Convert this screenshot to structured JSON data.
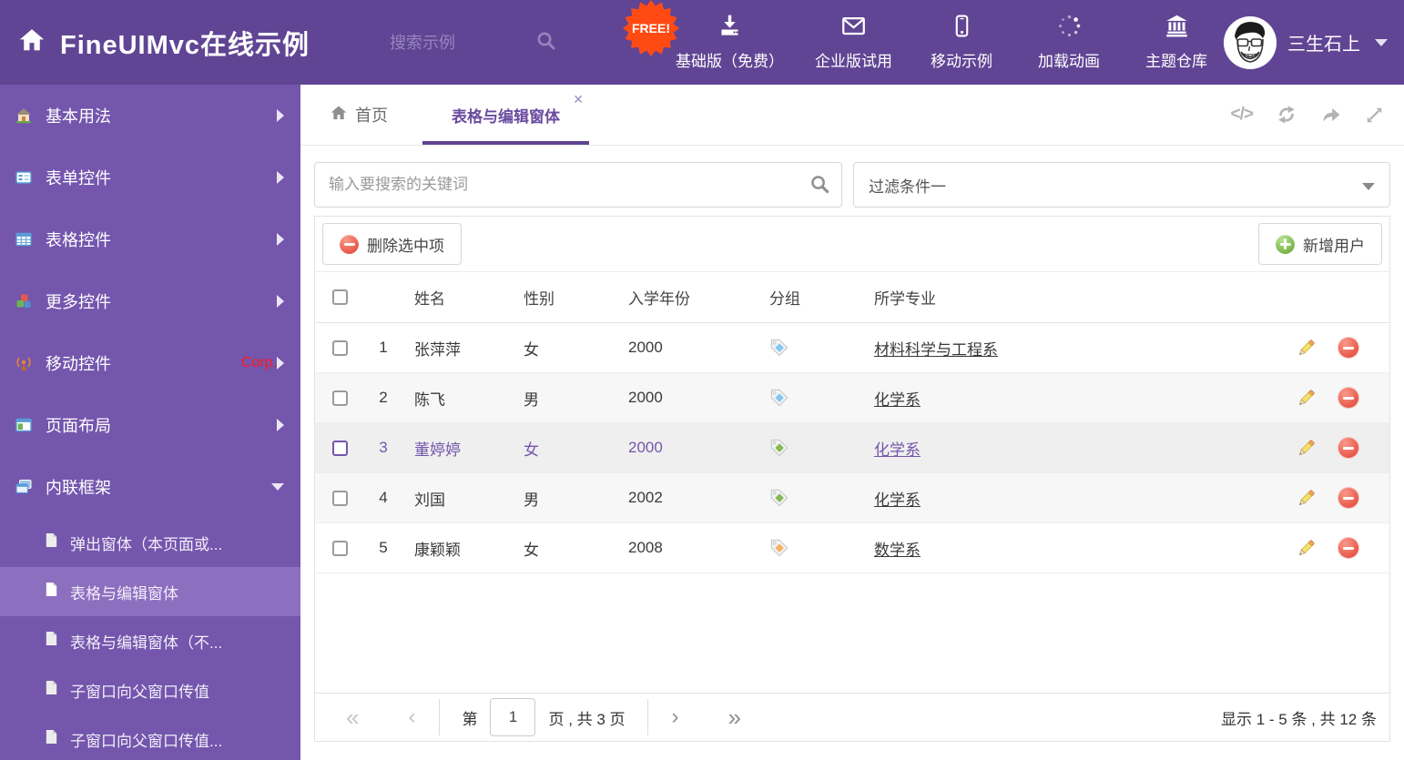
{
  "header": {
    "logo_title": "FineUIMvc在线示例",
    "search_placeholder": "搜索示例",
    "free_badge": "FREE!",
    "nav": [
      {
        "label": "基础版（免费）",
        "icon": "download-icon"
      },
      {
        "label": "企业版试用",
        "icon": "envelope-icon"
      },
      {
        "label": "移动示例",
        "icon": "phone-icon"
      },
      {
        "label": "加载动画",
        "icon": "spinner-icon"
      },
      {
        "label": "主题仓库",
        "icon": "bank-icon"
      }
    ],
    "username": "三生石上"
  },
  "sidebar": {
    "items": [
      {
        "label": "基本用法"
      },
      {
        "label": "表单控件"
      },
      {
        "label": "表格控件"
      },
      {
        "label": "更多控件"
      },
      {
        "label": "移动控件",
        "badge": "Corp."
      },
      {
        "label": "页面布局"
      },
      {
        "label": "内联框架",
        "expanded": true
      }
    ],
    "subitems": [
      {
        "label": "弹出窗体（本页面或..."
      },
      {
        "label": "表格与编辑窗体",
        "selected": true
      },
      {
        "label": "表格与编辑窗体（不..."
      },
      {
        "label": "子窗口向父窗口传值"
      },
      {
        "label": "子窗口向父窗口传值..."
      }
    ]
  },
  "tabs": [
    {
      "label": "首页"
    },
    {
      "label": "表格与编辑窗体",
      "active": true,
      "closable": true
    }
  ],
  "filters": {
    "search_placeholder": "输入要搜索的关键词",
    "filter_value": "过滤条件一"
  },
  "toolbar": {
    "delete_label": "删除选中项",
    "add_label": "新增用户"
  },
  "table": {
    "columns": [
      "姓名",
      "性别",
      "入学年份",
      "分组",
      "所学专业"
    ],
    "rows": [
      {
        "num": "1",
        "name": "张萍萍",
        "gender": "女",
        "year": "2000",
        "tag": "blue",
        "major": "材料科学与工程系"
      },
      {
        "num": "2",
        "name": "陈飞",
        "gender": "男",
        "year": "2000",
        "tag": "blue",
        "major": "化学系"
      },
      {
        "num": "3",
        "name": "董婷婷",
        "gender": "女",
        "year": "2000",
        "tag": "green",
        "major": "化学系",
        "selected": true
      },
      {
        "num": "4",
        "name": "刘国",
        "gender": "男",
        "year": "2002",
        "tag": "green",
        "major": "化学系"
      },
      {
        "num": "5",
        "name": "康颖颖",
        "gender": "女",
        "year": "2008",
        "tag": "orange",
        "major": "数学系"
      }
    ]
  },
  "pagination": {
    "page_prefix": "第",
    "page_value": "1",
    "page_suffix": "页 , 共 3 页",
    "summary": "显示 1 - 5 条 , 共 12 条"
  },
  "colors": {
    "header_bg": "#604594",
    "sidebar_bg": "#7456ad",
    "accent_purple": "#6a4b9f",
    "free_badge_bg": "#ff4a14",
    "tags": {
      "blue": "#85c6f2",
      "green": "#86b957",
      "orange": "#f7b26b"
    }
  }
}
